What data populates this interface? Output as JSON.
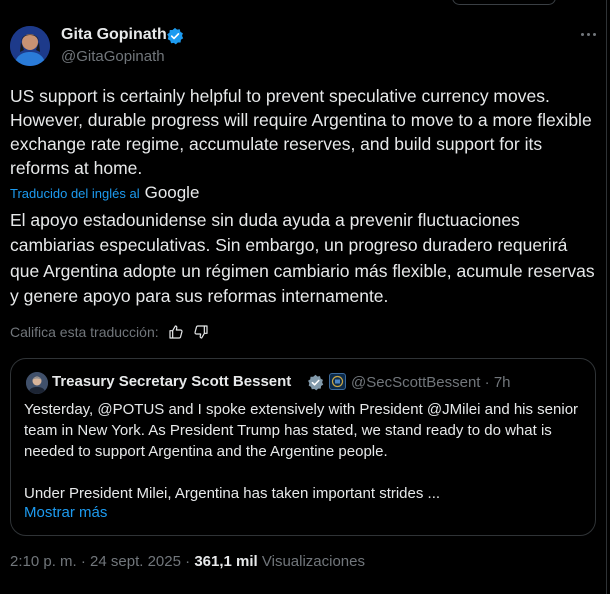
{
  "tweet": {
    "author_name": "Gita Gopinath",
    "author_handle": "@GitaGopinath",
    "text": "US support is certainly helpful to prevent speculative currency moves. However, durable progress will require Argentina to move to a more flexible exchange rate regime, accumulate reserves, and build support for its reforms at home.",
    "translated_label": "Traducido del inglés al",
    "translator_logo": "Google",
    "translation": "El apoyo estadounidense sin duda ayuda a prevenir fluctuaciones cambiarias especulativas. Sin embargo, un progreso duradero requerirá que Argentina adopte un régimen cambiario más flexible, acumule reservas y genere apoyo para sus reformas internamente.",
    "rate_translation_label": "Califica esta traducción:",
    "time": "2:10 p. m.",
    "separator": "·",
    "date": "24 sept. 2025",
    "views_count": "361,1 mil",
    "views_label": "Visualizaciones"
  },
  "quote": {
    "author_name": "Treasury Secretary Scott Bessent",
    "author_handle": "@SecScottBessent",
    "time_ago": "7h",
    "text": "Yesterday, @POTUS and I spoke extensively with President @JMilei and his senior team in New York.  As President Trump has stated, we stand ready to do what is needed to support Argentina and the Argentine people.\n\nUnder President Milei, Argentina has taken important strides ...",
    "show_more_label": "Mostrar más"
  },
  "colors": {
    "background": "#000000",
    "text_primary": "#e7e9ea",
    "text_secondary": "#71767b",
    "accent": "#1d9bf0",
    "border": "#2f3336"
  },
  "icons": {
    "verified": "verified-badge-icon",
    "more": "more-horizontal-icon",
    "thumbs_up": "thumbs-up-icon",
    "thumbs_down": "thumbs-down-icon",
    "affiliate": "treasury-seal-icon"
  }
}
